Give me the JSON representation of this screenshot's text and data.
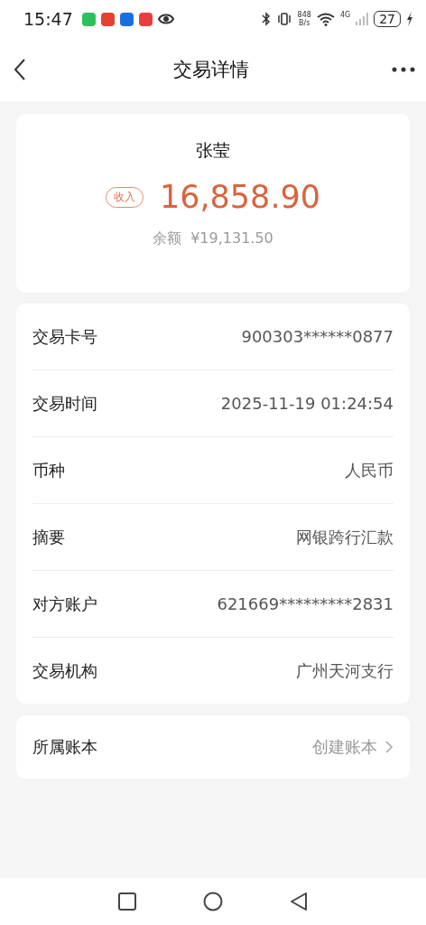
{
  "status_bar": {
    "time": "15:47",
    "net_speed_value": "848",
    "net_speed_unit": "B/s",
    "network": "4G",
    "battery": "27"
  },
  "header": {
    "title": "交易详情"
  },
  "summary": {
    "name": "张莹",
    "tag": "收入",
    "amount": "16,858.90",
    "balance_label": "余额",
    "balance": "¥19,131.50"
  },
  "details": [
    {
      "label": "交易卡号",
      "value": "900303******0877"
    },
    {
      "label": "交易时间",
      "value": "2025-11-19 01:24:54"
    },
    {
      "label": "币种",
      "value": "人民币"
    },
    {
      "label": "摘要",
      "value": "网银跨行汇款"
    },
    {
      "label": "对方账户",
      "value": "621669*********2831"
    },
    {
      "label": "交易机构",
      "value": "广州天河支行"
    }
  ],
  "ledger": {
    "label": "所属账本",
    "action": "创建账本"
  }
}
